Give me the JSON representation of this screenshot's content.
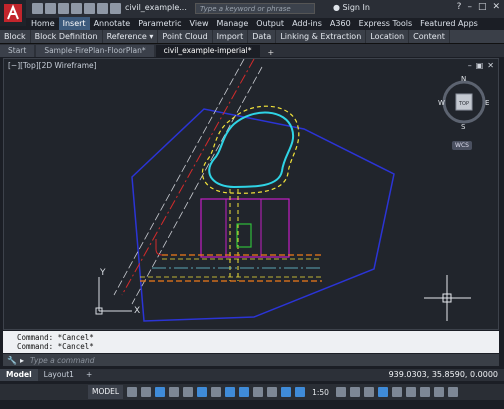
{
  "title_bar": {
    "document_title": "civil_example...",
    "search_placeholder": "Type a keyword or phrase",
    "sign_in": "Sign In",
    "help": "?"
  },
  "ribbon_tabs": [
    "Home",
    "Insert",
    "Annotate",
    "Parametric",
    "View",
    "Manage",
    "Output",
    "Add-ins",
    "A360",
    "Express Tools",
    "Featured Apps"
  ],
  "active_ribbon_tab": "Insert",
  "ribbon_panels": [
    "Block",
    "Block Definition",
    "Reference ▾",
    "Point Cloud",
    "Import",
    "Data",
    "Linking & Extraction",
    "Location",
    "Content"
  ],
  "file_tabs": [
    "Start",
    "Sample-FirePlan-FloorPlan*",
    "civil_example-imperial*"
  ],
  "active_file_tab": "civil_example-imperial*",
  "viewport": {
    "label": "[−][Top][2D Wireframe]",
    "viewcube": {
      "top": "TOP",
      "n": "N",
      "s": "S",
      "e": "E",
      "w": "W"
    },
    "wcs": "WCS",
    "ucs_x": "X",
    "ucs_y": "Y"
  },
  "command_history": [
    "Command: *Cancel*",
    "Command: *Cancel*"
  ],
  "command_placeholder": "Type a command",
  "layout_tabs": [
    "Model",
    "Layout1"
  ],
  "coordinates": "939.0303, 35.8590, 0.0000",
  "status": {
    "model": "MODEL",
    "scale": "1:50"
  },
  "colors": {
    "accent": "#3c5a7c",
    "viewport_bg": "#21252c",
    "red_line": "#d42b2b",
    "yellow_dash": "#f2e33a",
    "cyan": "#2fd4e6",
    "magenta": "#c21ec4",
    "blue_boundary": "#2b34d6",
    "orange_dash": "#ef7a1a",
    "green": "#2fbf3a"
  }
}
